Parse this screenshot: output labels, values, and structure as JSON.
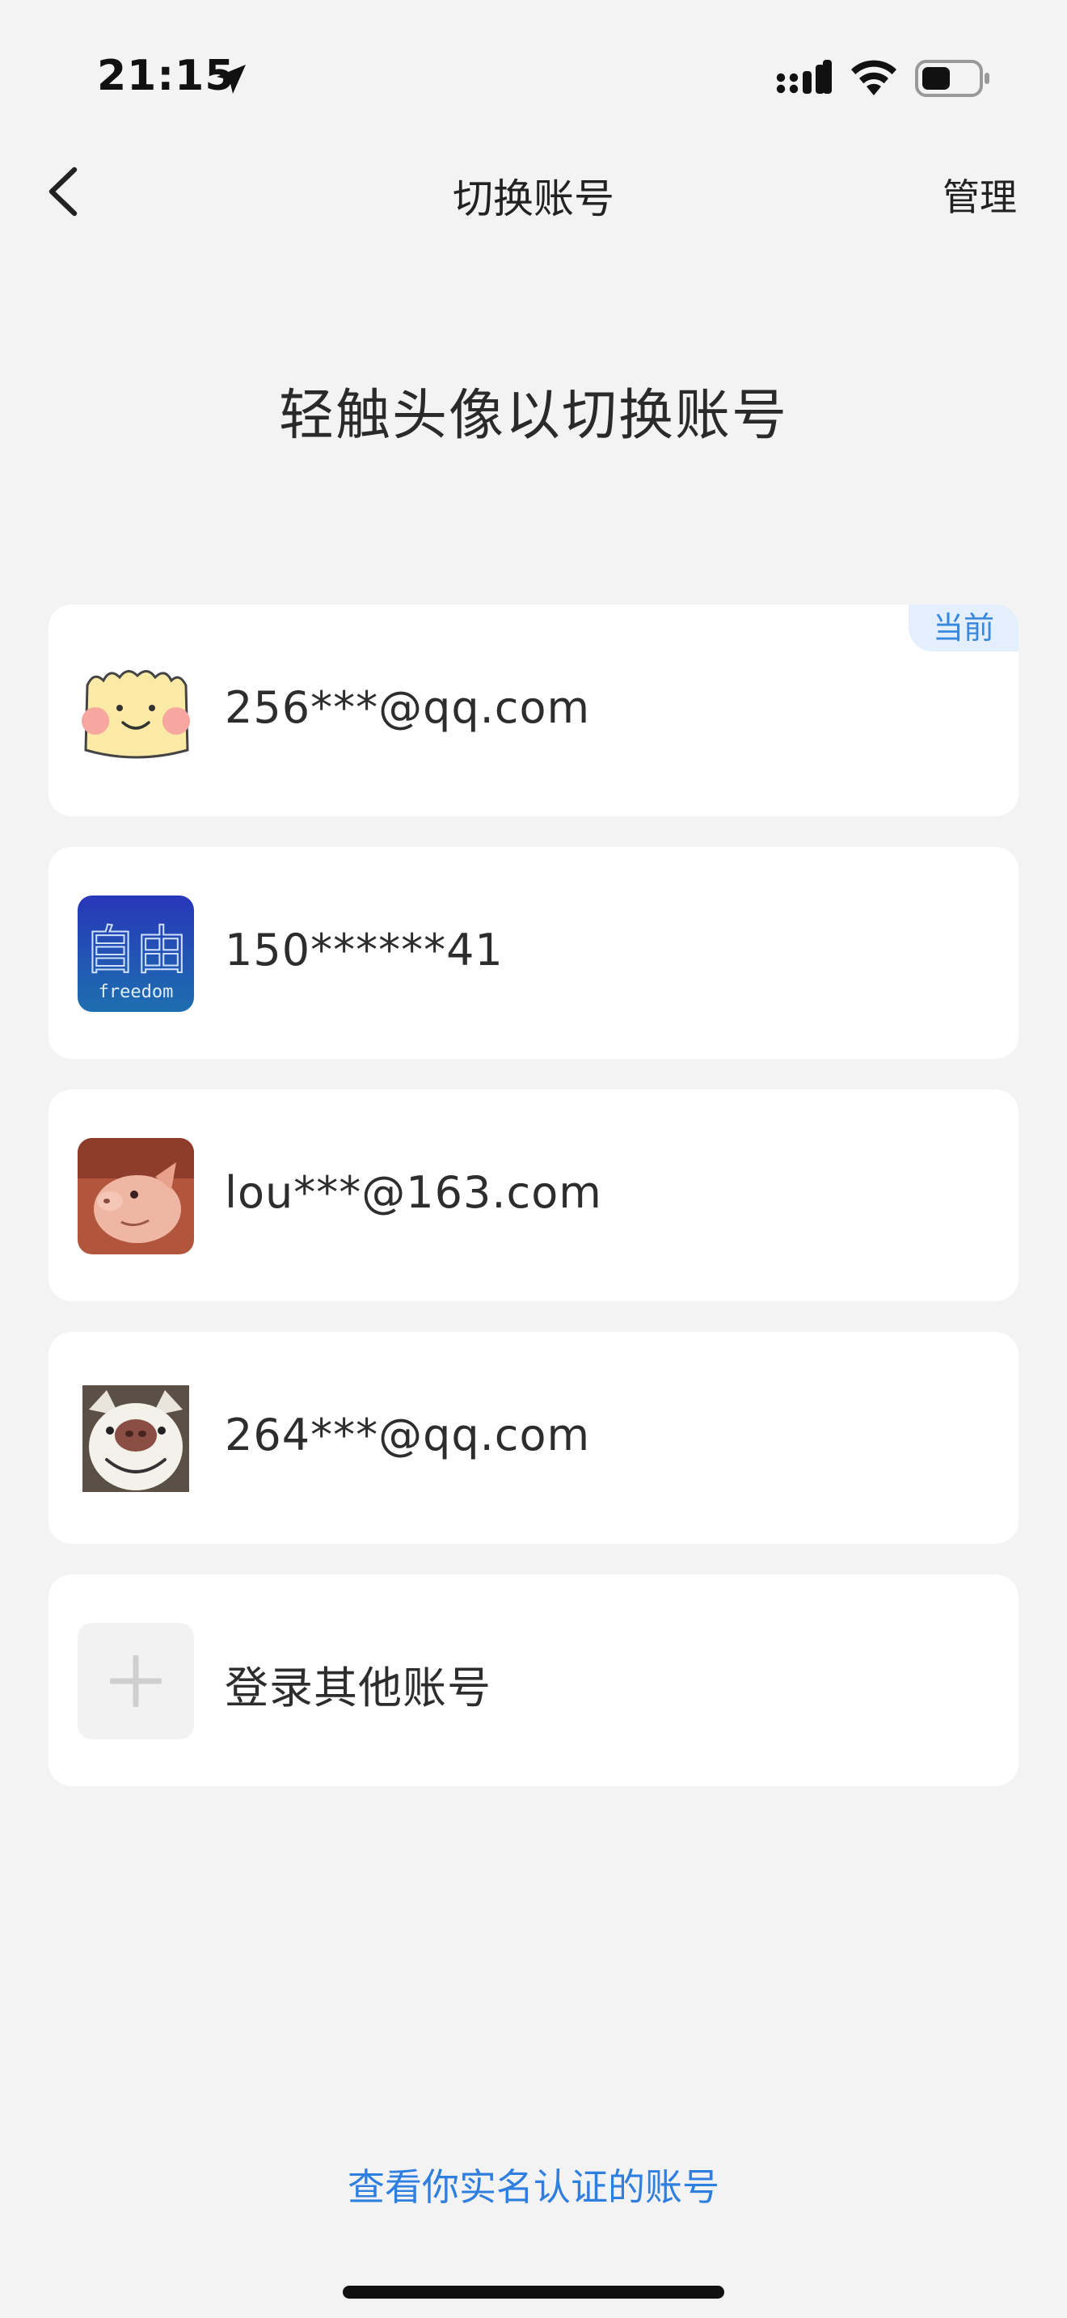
{
  "status_bar": {
    "time": "21:15",
    "icons": [
      "location-arrow-icon",
      "cellular-signal-icon",
      "wifi-icon",
      "battery-icon"
    ]
  },
  "nav": {
    "back_icon": "chevron-left-icon",
    "title": "切换账号",
    "manage_label": "管理"
  },
  "heading": "轻触头像以切换账号",
  "accounts": [
    {
      "name": "256***@qq.com",
      "avatar": "cartoon-face-avatar",
      "current_badge": "当前"
    },
    {
      "name": "150******41",
      "avatar": "freedom-text-avatar",
      "avatar_text": "自由",
      "avatar_subtext": "freedom"
    },
    {
      "name": "lou***@163.com",
      "avatar": "piglet-avatar"
    },
    {
      "name": "264***@qq.com",
      "avatar": "smiling-dog-avatar"
    }
  ],
  "add_account": {
    "label": "登录其他账号",
    "icon": "plus-icon"
  },
  "footer": {
    "verify_link": "查看你实名认证的账号"
  },
  "colors": {
    "background": "#f3f3f3",
    "card": "#ffffff",
    "accent_blue": "#2f7fe0",
    "badge_bg": "#e3effd"
  }
}
